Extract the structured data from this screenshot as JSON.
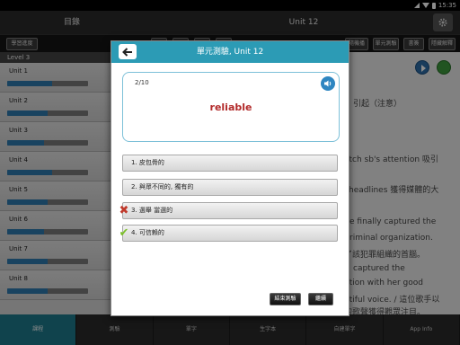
{
  "status": {
    "time": "15:35"
  },
  "header": {
    "left_title": "目錄",
    "center_title": "Unit 12"
  },
  "toolbar": {
    "learning_progress": "學習進度",
    "hidden_buttons": [
      "",
      "",
      "",
      ""
    ],
    "right_buttons": [
      "隨機播",
      "單元測驗",
      "書簽",
      "隱藏解釋"
    ]
  },
  "sidebar": {
    "level": "Level 3",
    "units": [
      {
        "label": "Unit 1",
        "progress": 0.55
      },
      {
        "label": "Unit 2",
        "progress": 0.5
      },
      {
        "label": "Unit 3",
        "progress": 0.45
      },
      {
        "label": "Unit 4",
        "progress": 0.55
      },
      {
        "label": "Unit 5",
        "progress": 0.5
      },
      {
        "label": "Unit 6",
        "progress": 0.45
      },
      {
        "label": "Unit 7",
        "progress": 0.5
      },
      {
        "label": "Unit 8",
        "progress": 0.5
      }
    ]
  },
  "content": {
    "lines": [
      "引起（注意）",
      "atch sb's attention  吸引",
      "headlines  獲得媒體的大",
      "e finally captured the",
      "riminal organization.",
      "了該犯罪組織的首腦。",
      "captured the",
      "ntion with her good",
      "utiful voice. / 這位歌手以",
      "的歌聲獲得觀眾注目。"
    ]
  },
  "modal": {
    "title": "單元測驗, Unit 12",
    "counter": "2/10",
    "word": "reliable",
    "options": [
      {
        "text": "1. 皮包骨的",
        "mark": ""
      },
      {
        "text": "2. 與眾不同的, 獨有的",
        "mark": ""
      },
      {
        "text": "3. 選舉  當選的",
        "mark": "wrong"
      },
      {
        "text": "4. 可信賴的",
        "mark": "correct"
      }
    ],
    "end_button": "結束測驗",
    "continue_button": "繼續"
  },
  "bottom_nav": [
    "課程",
    "測驗",
    "單字",
    "生字本",
    "自建單字",
    "App Info"
  ],
  "colors": {
    "accent": "#2c9bb5",
    "word": "#b22a2a",
    "wrong": "#c0392b",
    "correct": "#7cbf2a"
  }
}
